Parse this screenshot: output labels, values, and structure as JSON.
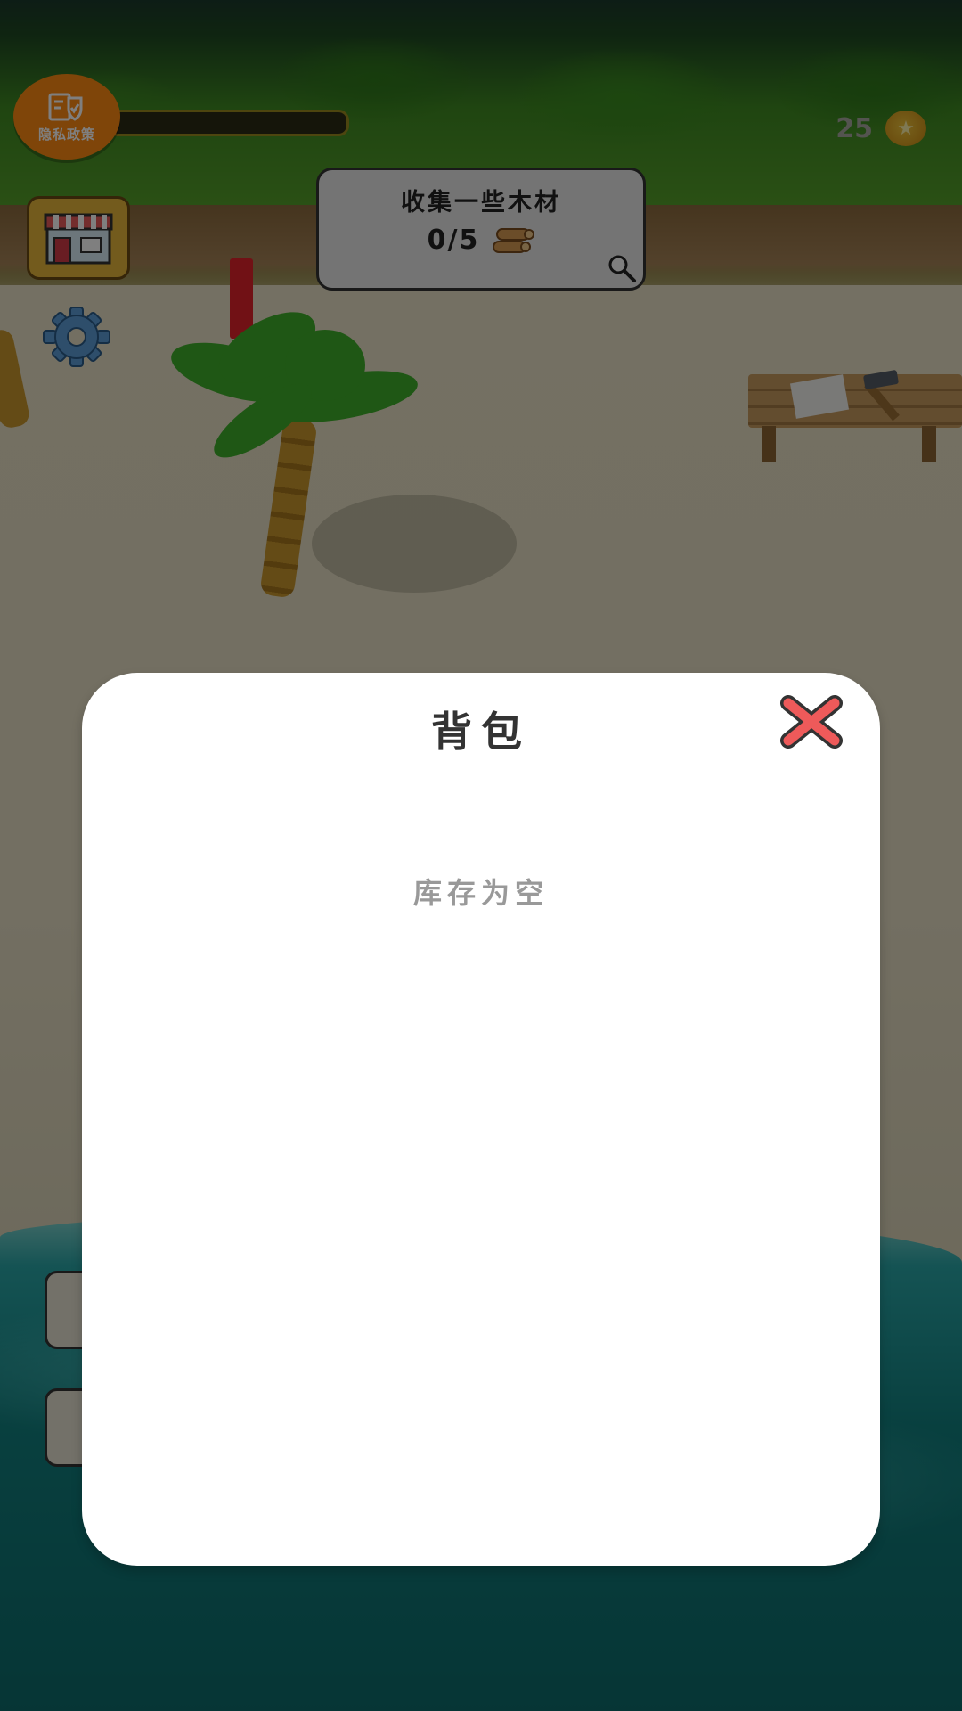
{
  "hud": {
    "privacy_label": "隐私政策",
    "coin_count": "25",
    "progress_fraction": 0.0
  },
  "quest": {
    "title": "收集一些木材",
    "progress": "0/5"
  },
  "inventory_modal": {
    "title": "背包",
    "empty_message": "库存为空"
  },
  "colors": {
    "privacy_button": "#ff8a12",
    "close_x": "#ee5a5a",
    "coin": "#d79b1d"
  },
  "icons": {
    "privacy": "shield-document-icon",
    "shop": "shop-icon",
    "settings": "gear-icon",
    "wood": "wood-logs-icon",
    "search": "magnifier-icon",
    "coin": "star-coin-icon",
    "close": "close-x-icon"
  }
}
